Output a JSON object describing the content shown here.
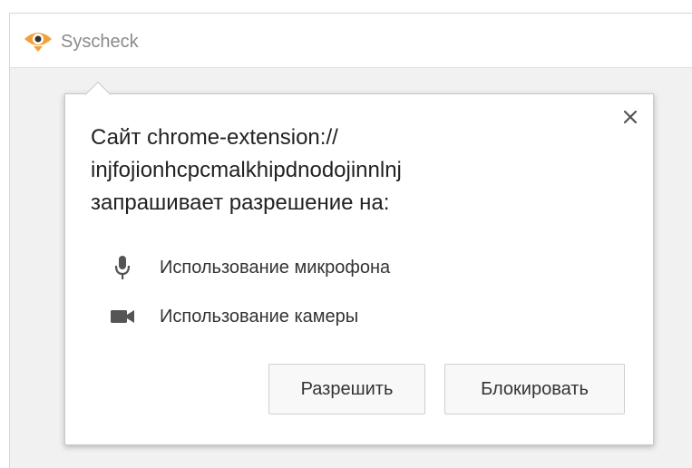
{
  "tab": {
    "title": "Syscheck",
    "logo_icon": "eye-logo-icon"
  },
  "dialog": {
    "message_lines": [
      "Сайт chrome-extension://",
      "injfojionhcpcmalkhipdnodojinnlnj",
      "запрашивает разрешение на:"
    ],
    "close_icon": "close-icon",
    "permissions": [
      {
        "icon": "microphone-icon",
        "label": "Использование микрофона"
      },
      {
        "icon": "camera-icon",
        "label": "Использование камеры"
      }
    ],
    "allow_label": "Разрешить",
    "block_label": "Блокировать"
  },
  "colors": {
    "logo_orange": "#f2a03a",
    "logo_dark": "#333333",
    "icon_gray": "#555555"
  }
}
